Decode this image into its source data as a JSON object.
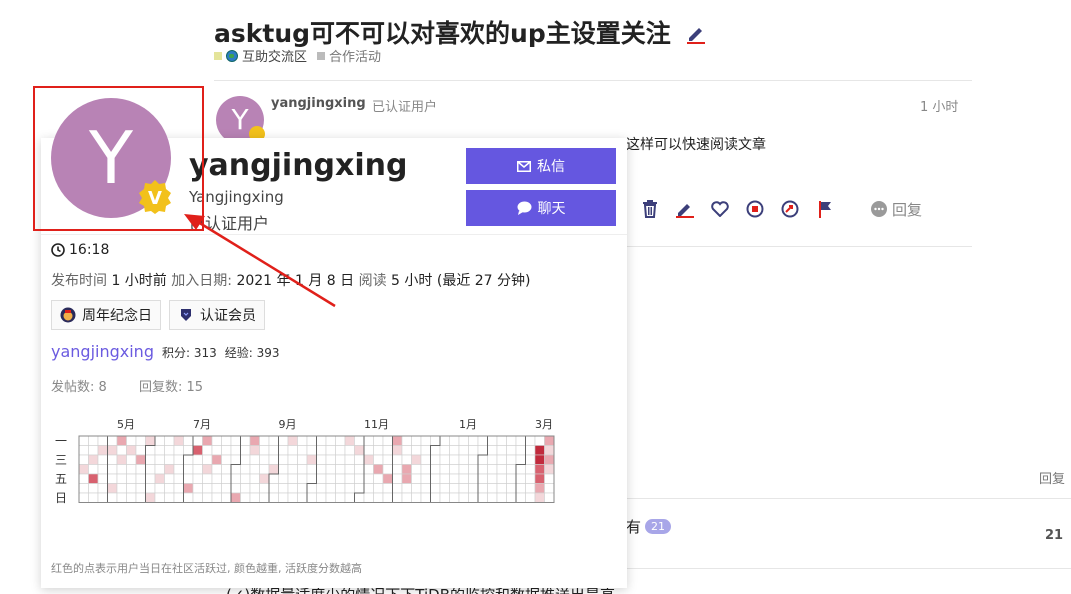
{
  "topic": {
    "title": "asktug可不可以对喜欢的up主设置关注",
    "category": "互助交流区",
    "subcategory": "合作活动",
    "category_color": "#e4e49a",
    "subcategory_color": "#bbbbbb"
  },
  "post": {
    "avatar_letter": "Y",
    "username": "yangjingxing",
    "user_title": "已认证用户",
    "time": "1 小时",
    "body_tail": "这样可以快速阅读文章",
    "reply_label": "回复"
  },
  "related": {
    "reply_header": "回复",
    "row1_tail": "有",
    "row1_pill": "21",
    "row1_count": "21",
    "row2_text": "(✓)数据量适度少的情况下下TiDB的监控和数据推送出是高"
  },
  "card": {
    "avatar_letter": "Y",
    "badge_letter": "V",
    "username": "yangjingxing",
    "full_name": "Yangjingxing",
    "title": "已认证用户",
    "pm_label": "私信",
    "chat_label": "聊天",
    "local_time": "16:18",
    "meta": {
      "posted_label": "发布时间",
      "posted_value": "1 小时前",
      "joined_label": "加入日期:",
      "joined_value": "2021 年 1 月 8 日",
      "read_label": "阅读",
      "read_value": "5 小时 (最近 27 分钟)"
    },
    "badges": [
      {
        "name": "周年纪念日",
        "icon": "anniversary-icon"
      },
      {
        "name": "认证会员",
        "icon": "shield-icon"
      }
    ],
    "userline": {
      "link": "yangjingxing",
      "points": "积分: 313",
      "exp": "经验: 393"
    },
    "stats": {
      "posts": "发帖数: 8",
      "replies": "回复数: 15"
    },
    "heatmap": {
      "months": [
        "5月",
        "7月",
        "9月",
        "11月",
        "1月",
        "3月"
      ],
      "month_cols": [
        4,
        12,
        21,
        30,
        40,
        48
      ],
      "weekday_labels": [
        "一",
        "三",
        "五",
        "日"
      ],
      "weekday_rows": [
        0,
        2,
        4,
        6
      ],
      "weeks": 53,
      "colors": [
        "#ffffff",
        "#f3d7da",
        "#e9a8b0",
        "#d8616f",
        "#c12a3c"
      ],
      "cells": [
        [
          0,
          1,
          2,
          1,
          0
        ],
        [
          0,
          2,
          1,
          2,
          0
        ],
        [
          0,
          4,
          1,
          2,
          1
        ],
        [
          0,
          5,
          2,
          1,
          1
        ],
        [
          1,
          3,
          1,
          2,
          0
        ],
        [
          1,
          5,
          1,
          1,
          2
        ],
        [
          2,
          1,
          1,
          2,
          1
        ],
        [
          2,
          3,
          1,
          1,
          1
        ],
        [
          3,
          0,
          1,
          2,
          1
        ],
        [
          3,
          5,
          1,
          1,
          1
        ],
        [
          4,
          3,
          1,
          2,
          1
        ],
        [
          4,
          1,
          1,
          1,
          1
        ],
        [
          5,
          2,
          1,
          2,
          1
        ],
        [
          5,
          3,
          1,
          1,
          1
        ],
        [
          6,
          0,
          1,
          2,
          0
        ],
        [
          6,
          5,
          1,
          1,
          1
        ],
        [
          7,
          3,
          1,
          2,
          1
        ],
        [
          7,
          2,
          1,
          1,
          1
        ],
        [
          8,
          1,
          1,
          2,
          1
        ],
        [
          9,
          2,
          1,
          1,
          0
        ],
        [
          10,
          4,
          1,
          2,
          1
        ],
        [
          11,
          6,
          1,
          1,
          1
        ],
        [
          12,
          5,
          1,
          2,
          1
        ],
        [
          13,
          3,
          1,
          1,
          0
        ],
        [
          14,
          1,
          1,
          2,
          1
        ],
        [
          15,
          0,
          1,
          1,
          1
        ],
        [
          16,
          1,
          1,
          2,
          0
        ],
        [
          17,
          3,
          1,
          1,
          1
        ],
        [
          18,
          4,
          1,
          2,
          1
        ],
        [
          19,
          2,
          1,
          1,
          1
        ],
        [
          20,
          1,
          1,
          2,
          0
        ],
        [
          21,
          3,
          1,
          1,
          1
        ],
        [
          22,
          4,
          1,
          2,
          0
        ],
        [
          23,
          5,
          1,
          1,
          1
        ],
        [
          24,
          1,
          1,
          2,
          0
        ],
        [
          25,
          2,
          1,
          1,
          1
        ],
        [
          26,
          3,
          1,
          2,
          1
        ],
        [
          27,
          4,
          1,
          1,
          0
        ],
        [
          28,
          0,
          1,
          2,
          1
        ],
        [
          29,
          1,
          1,
          1,
          1
        ],
        [
          30,
          2,
          1,
          2,
          1
        ],
        [
          31,
          3,
          1,
          1,
          0
        ],
        [
          32,
          4,
          1,
          2,
          1
        ],
        [
          33,
          5,
          1,
          1,
          0
        ],
        [
          34,
          6,
          1,
          2,
          1
        ],
        [
          35,
          0,
          1,
          1,
          1
        ],
        [
          36,
          1,
          1,
          2,
          0
        ],
        [
          37,
          2,
          1,
          1,
          1
        ],
        [
          38,
          3,
          1,
          2,
          0
        ],
        [
          39,
          4,
          1,
          1,
          1
        ],
        [
          40,
          5,
          1,
          2,
          0
        ],
        [
          41,
          6,
          1,
          1,
          1
        ],
        [
          42,
          0,
          1,
          2,
          0
        ],
        [
          43,
          1,
          1,
          1,
          1
        ],
        [
          44,
          2,
          1,
          2,
          1
        ],
        [
          45,
          3,
          1,
          1,
          1
        ],
        [
          46,
          4,
          1,
          2,
          0
        ],
        [
          47,
          5,
          1,
          1,
          0
        ],
        [
          48,
          6,
          1,
          2,
          1
        ],
        [
          49,
          0,
          1,
          1,
          0
        ],
        [
          50,
          1,
          1,
          2,
          1
        ],
        [
          51,
          2,
          1,
          1,
          1
        ],
        [
          52,
          3,
          1,
          2,
          0
        ]
      ],
      "active": [
        [
          0,
          3,
          1
        ],
        [
          1,
          2,
          1
        ],
        [
          1,
          4,
          3
        ],
        [
          2,
          1,
          1
        ],
        [
          3,
          5,
          1
        ],
        [
          3,
          1,
          1
        ],
        [
          4,
          0,
          2
        ],
        [
          4,
          2,
          1
        ],
        [
          5,
          1,
          1
        ],
        [
          6,
          2,
          2
        ],
        [
          7,
          0,
          1
        ],
        [
          7,
          6,
          1
        ],
        [
          8,
          4,
          1
        ],
        [
          9,
          3,
          1
        ],
        [
          10,
          0,
          1
        ],
        [
          11,
          5,
          2
        ],
        [
          12,
          1,
          3
        ],
        [
          13,
          0,
          2
        ],
        [
          13,
          3,
          1
        ],
        [
          14,
          2,
          2
        ],
        [
          16,
          6,
          2
        ],
        [
          17,
          7,
          3
        ],
        [
          18,
          0,
          2
        ],
        [
          18,
          1,
          1
        ],
        [
          19,
          4,
          1
        ],
        [
          20,
          3,
          1
        ],
        [
          22,
          0,
          1
        ],
        [
          24,
          2,
          1
        ],
        [
          28,
          0,
          1
        ],
        [
          29,
          1,
          1
        ],
        [
          30,
          2,
          1
        ],
        [
          31,
          3,
          2
        ],
        [
          32,
          4,
          2
        ],
        [
          33,
          0,
          2
        ],
        [
          33,
          1,
          1
        ],
        [
          34,
          3,
          2
        ],
        [
          34,
          4,
          2
        ],
        [
          35,
          2,
          1
        ],
        [
          48,
          1,
          4
        ],
        [
          48,
          2,
          4
        ],
        [
          48,
          3,
          3
        ],
        [
          48,
          4,
          3
        ],
        [
          48,
          5,
          2
        ],
        [
          48,
          6,
          1
        ],
        [
          49,
          0,
          2
        ],
        [
          49,
          1,
          1
        ],
        [
          49,
          2,
          2
        ],
        [
          49,
          3,
          1
        ]
      ]
    },
    "footnote": "红色的点表示用户当日在社区活跃过, 颜色越重, 活跃度分数越高"
  }
}
